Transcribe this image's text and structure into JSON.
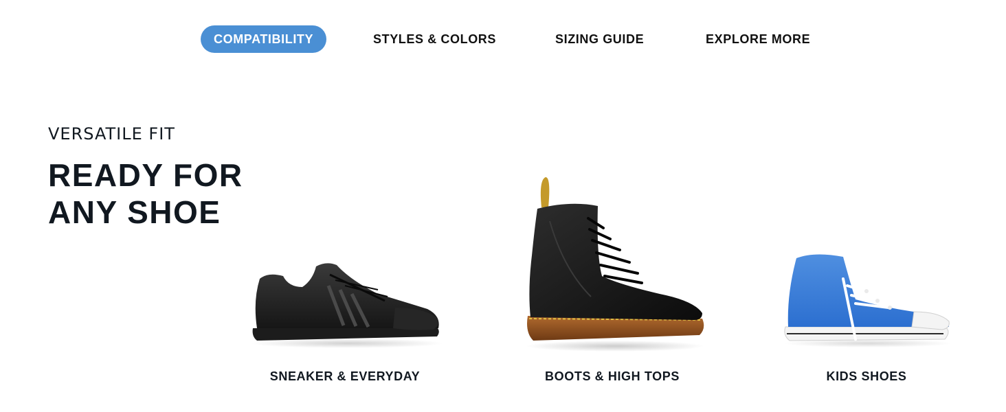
{
  "tabs": [
    {
      "label": "COMPATIBILITY",
      "active": true
    },
    {
      "label": "STYLES & COLORS",
      "active": false
    },
    {
      "label": "SIZING GUIDE",
      "active": false
    },
    {
      "label": "EXPLORE MORE",
      "active": false
    }
  ],
  "hero": {
    "eyebrow": "VERSATILE FIT",
    "headline_line1": "READY FOR",
    "headline_line2": "ANY SHOE"
  },
  "products": [
    {
      "label": "SNEAKER & EVERYDAY",
      "image": "black-sneaker-icon"
    },
    {
      "label": "BOOTS & HIGH TOPS",
      "image": "black-boot-icon"
    },
    {
      "label": "KIDS SHOES",
      "image": "blue-high-top-icon"
    }
  ],
  "colors": {
    "accent": "#4a8fd4",
    "text": "#111820",
    "background": "#ffffff"
  }
}
